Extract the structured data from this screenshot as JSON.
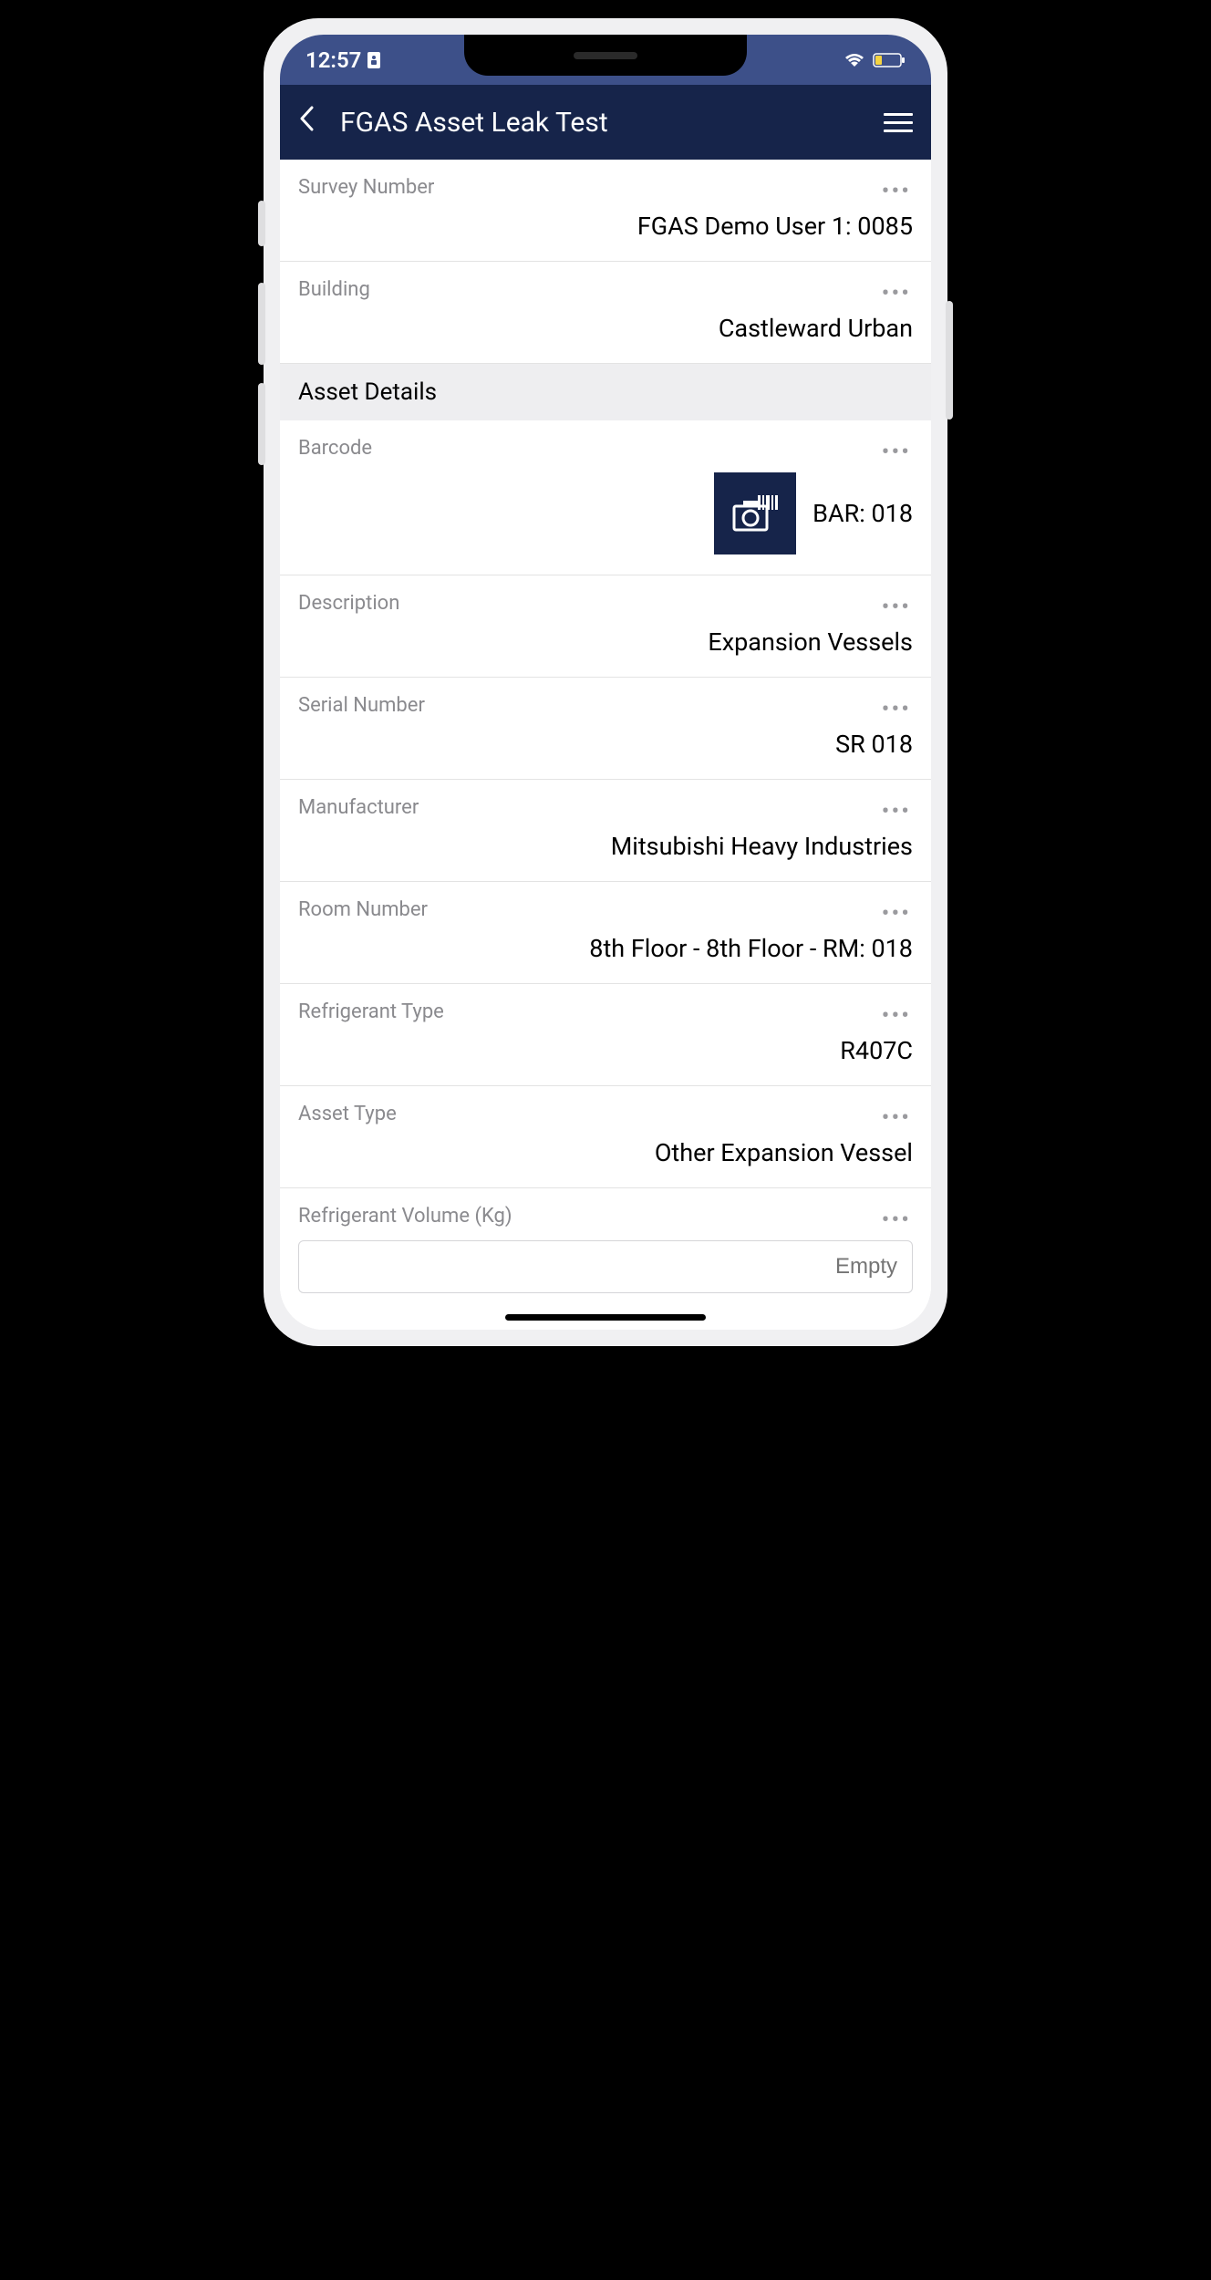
{
  "status": {
    "time": "12:57"
  },
  "header": {
    "title": "FGAS Asset Leak Test"
  },
  "fields": {
    "survey_number": {
      "label": "Survey Number",
      "value": "FGAS Demo User 1: 0085"
    },
    "building": {
      "label": "Building",
      "value": "Castleward Urban"
    },
    "section_asset": "Asset Details",
    "barcode": {
      "label": "Barcode",
      "value": "BAR: 018"
    },
    "description": {
      "label": "Description",
      "value": "Expansion Vessels"
    },
    "serial_number": {
      "label": "Serial Number",
      "value": "SR 018"
    },
    "manufacturer": {
      "label": "Manufacturer",
      "value": "Mitsubishi Heavy Industries"
    },
    "room_number": {
      "label": "Room Number",
      "value": "8th Floor - 8th Floor - RM: 018"
    },
    "refrigerant_type": {
      "label": "Refrigerant Type",
      "value": "R407C"
    },
    "asset_type": {
      "label": "Asset Type",
      "value": "Other Expansion Vessel"
    },
    "refrigerant_volume": {
      "label": "Refrigerant Volume (Kg)",
      "placeholder": "Empty"
    }
  }
}
